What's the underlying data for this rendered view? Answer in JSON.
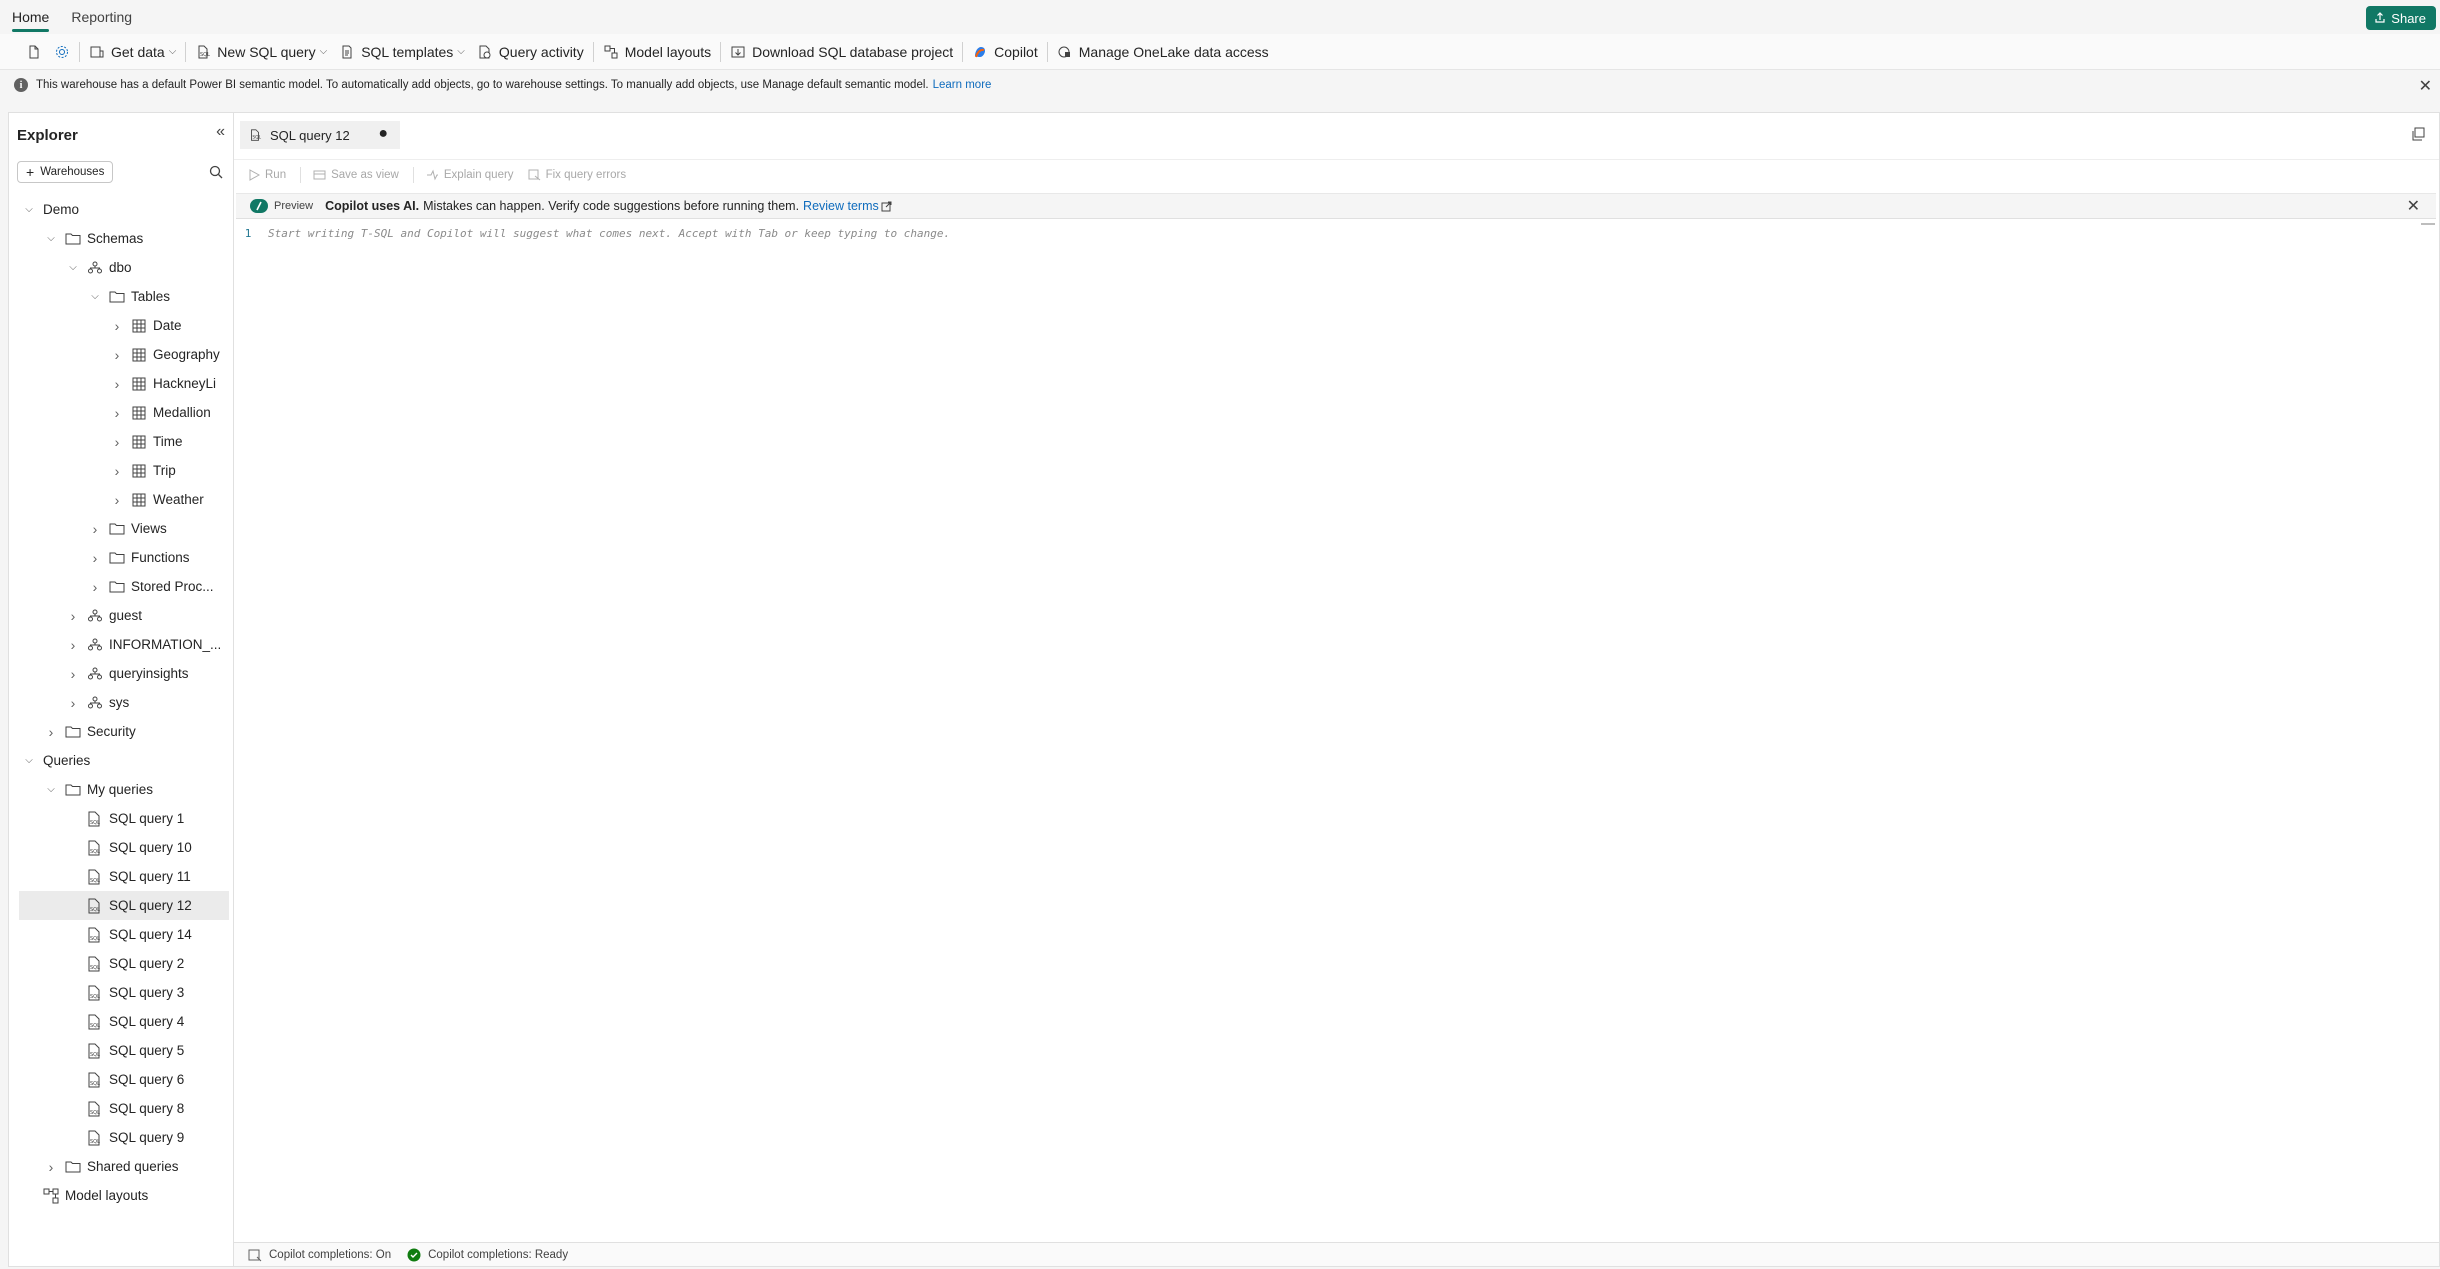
{
  "top_tabs": [
    "Home",
    "Reporting"
  ],
  "share_label": "Share",
  "ribbon": {
    "get_data": "Get data",
    "new_sql_query": "New SQL query",
    "sql_templates": "SQL templates",
    "query_activity": "Query activity",
    "model_layouts": "Model layouts",
    "download_project": "Download SQL database project",
    "copilot": "Copilot",
    "manage_onelake": "Manage OneLake data access"
  },
  "info": {
    "message": "This warehouse has a default Power BI semantic model. To automatically add objects, go to warehouse settings. To manually add objects, use Manage default semantic model.",
    "link": "Learn more"
  },
  "explorer": {
    "title": "Explorer",
    "warehouses_button": "Warehouses",
    "tree": [
      {
        "label": "Demo",
        "depth": 0,
        "caret": "open",
        "icon": "none"
      },
      {
        "label": "Schemas",
        "depth": 1,
        "caret": "open",
        "icon": "folder"
      },
      {
        "label": "dbo",
        "depth": 2,
        "caret": "open",
        "icon": "schema"
      },
      {
        "label": "Tables",
        "depth": 3,
        "caret": "open",
        "icon": "folder"
      },
      {
        "label": "Date",
        "depth": 4,
        "caret": "closed",
        "icon": "table"
      },
      {
        "label": "Geography",
        "depth": 4,
        "caret": "closed",
        "icon": "table"
      },
      {
        "label": "HackneyLi",
        "depth": 4,
        "caret": "closed",
        "icon": "table"
      },
      {
        "label": "Medallion",
        "depth": 4,
        "caret": "closed",
        "icon": "table"
      },
      {
        "label": "Time",
        "depth": 4,
        "caret": "closed",
        "icon": "table"
      },
      {
        "label": "Trip",
        "depth": 4,
        "caret": "closed",
        "icon": "table"
      },
      {
        "label": "Weather",
        "depth": 4,
        "caret": "closed",
        "icon": "table"
      },
      {
        "label": "Views",
        "depth": 3,
        "caret": "closed",
        "icon": "folder"
      },
      {
        "label": "Functions",
        "depth": 3,
        "caret": "closed",
        "icon": "folder"
      },
      {
        "label": "Stored Proc...",
        "depth": 3,
        "caret": "closed",
        "icon": "folder"
      },
      {
        "label": "guest",
        "depth": 2,
        "caret": "closed",
        "icon": "schema"
      },
      {
        "label": "INFORMATION_...",
        "depth": 2,
        "caret": "closed",
        "icon": "schema"
      },
      {
        "label": "queryinsights",
        "depth": 2,
        "caret": "closed",
        "icon": "schema"
      },
      {
        "label": "sys",
        "depth": 2,
        "caret": "closed",
        "icon": "schema"
      },
      {
        "label": "Security",
        "depth": 1,
        "caret": "closed",
        "icon": "folder"
      },
      {
        "label": "Queries",
        "depth": 0,
        "caret": "open",
        "icon": "none"
      },
      {
        "label": "My queries",
        "depth": 1,
        "caret": "open",
        "icon": "folder"
      },
      {
        "label": "SQL query 1",
        "depth": 2,
        "caret": "none",
        "icon": "query"
      },
      {
        "label": "SQL query 10",
        "depth": 2,
        "caret": "none",
        "icon": "query"
      },
      {
        "label": "SQL query 11",
        "depth": 2,
        "caret": "none",
        "icon": "query"
      },
      {
        "label": "SQL query 12",
        "depth": 2,
        "caret": "none",
        "icon": "query",
        "selected": true
      },
      {
        "label": "SQL query 14",
        "depth": 2,
        "caret": "none",
        "icon": "query"
      },
      {
        "label": "SQL query 2",
        "depth": 2,
        "caret": "none",
        "icon": "query"
      },
      {
        "label": "SQL query 3",
        "depth": 2,
        "caret": "none",
        "icon": "query"
      },
      {
        "label": "SQL query 4",
        "depth": 2,
        "caret": "none",
        "icon": "query"
      },
      {
        "label": "SQL query 5",
        "depth": 2,
        "caret": "none",
        "icon": "query"
      },
      {
        "label": "SQL query 6",
        "depth": 2,
        "caret": "none",
        "icon": "query"
      },
      {
        "label": "SQL query 8",
        "depth": 2,
        "caret": "none",
        "icon": "query"
      },
      {
        "label": "SQL query 9",
        "depth": 2,
        "caret": "none",
        "icon": "query"
      },
      {
        "label": "Shared queries",
        "depth": 1,
        "caret": "closed",
        "icon": "folder"
      },
      {
        "label": "Model layouts",
        "depth": 0,
        "caret": "blank",
        "icon": "model"
      }
    ]
  },
  "editor": {
    "tab_label": "SQL query 12",
    "tab_dirty": "●",
    "toolbar": {
      "run": "Run",
      "save_as_view": "Save as view",
      "explain_query": "Explain query",
      "fix_query_errors": "Fix query errors"
    },
    "copilot_bar": {
      "badge": "Preview",
      "bold": "Copilot uses AI.",
      "text": "Mistakes can happen. Verify code suggestions before running them.",
      "link": "Review terms"
    },
    "line_number": "1",
    "placeholder": "Start writing T-SQL and Copilot will suggest what comes next. Accept with Tab or keep typing to change."
  },
  "status": {
    "completions_on": "Copilot completions: On",
    "completions_ready": "Copilot completions: Ready"
  },
  "colors": {
    "accent": "#117865",
    "link": "#0f6cbd",
    "ready": "#107c10"
  }
}
